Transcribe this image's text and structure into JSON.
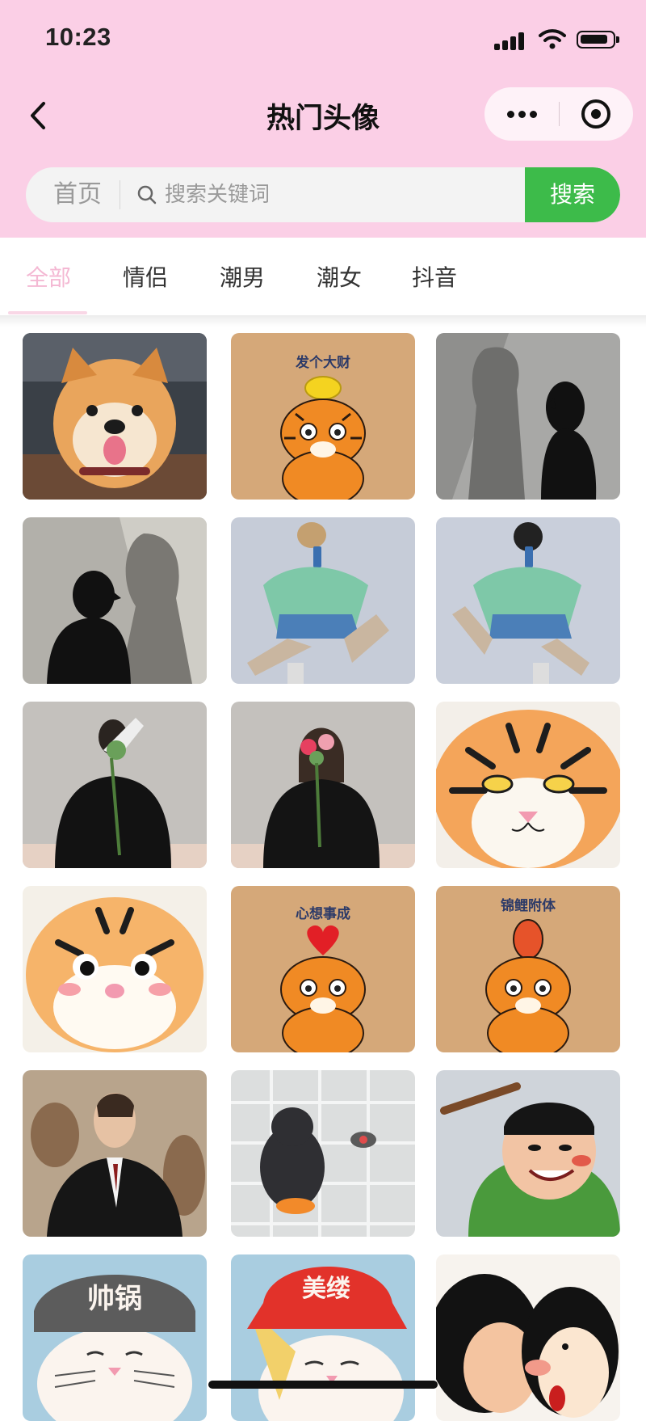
{
  "status_bar": {
    "time": "10:23"
  },
  "nav": {
    "title": "热门头像"
  },
  "search": {
    "home_label": "首页",
    "placeholder": "搜索关键词",
    "button_label": "搜索"
  },
  "tabs": [
    {
      "label": "全部",
      "active": true
    },
    {
      "label": "情侣",
      "active": false
    },
    {
      "label": "潮男",
      "active": false
    },
    {
      "label": "潮女",
      "active": false
    },
    {
      "label": "抖音",
      "active": false
    }
  ],
  "avatars": [
    {
      "subject": "shiba-dog"
    },
    {
      "subject": "tiger-gold",
      "caption": "发个大财"
    },
    {
      "subject": "shadow-girl"
    },
    {
      "subject": "shadow-boy"
    },
    {
      "subject": "mirror-selfie-boy"
    },
    {
      "subject": "mirror-selfie-girl"
    },
    {
      "subject": "flower-boy"
    },
    {
      "subject": "flower-girl"
    },
    {
      "subject": "tiger-face"
    },
    {
      "subject": "tiger-cute"
    },
    {
      "subject": "tiger-heart",
      "caption": "心想事成"
    },
    {
      "subject": "tiger-fish",
      "caption": "锦鲤附体"
    },
    {
      "subject": "suit-man"
    },
    {
      "subject": "penguin-toy"
    },
    {
      "subject": "cartoon-green"
    },
    {
      "subject": "cat-bowl",
      "caption": "帅锅"
    },
    {
      "subject": "cat-hat",
      "caption": "美缕"
    },
    {
      "subject": "cartoon-kiss"
    }
  ],
  "colors": {
    "header_bg": "#fbcfe6",
    "accent_green": "#3dbb4a",
    "active_tab": "#f4b8d3"
  }
}
